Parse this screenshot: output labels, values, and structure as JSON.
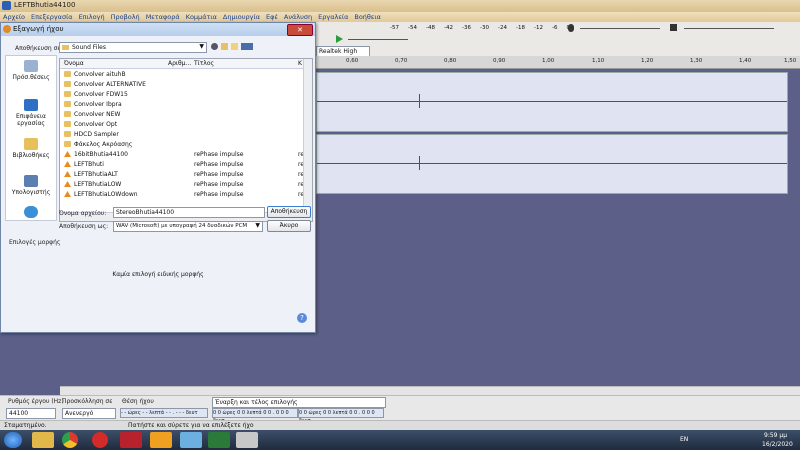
{
  "window": {
    "title": "LEFTBhutia44100"
  },
  "menu": [
    "Αρχείο",
    "Επεξεργασία",
    "Επιλογή",
    "Προβολή",
    "Μεταφορά",
    "Κομμάτια",
    "Δημιουργία",
    "Εφέ",
    "Ανάλυση",
    "Εργαλεία",
    "Βοήθεια"
  ],
  "toolbar": {
    "level_ticks": [
      "-57",
      "-54",
      "-48",
      "-42",
      "-36",
      "-30",
      "-24",
      "-18",
      "-12",
      "-6",
      "0"
    ],
    "device": "Realtek High"
  },
  "timeline": {
    "ticks": [
      "0,60",
      "0,70",
      "0,80",
      "0,90",
      "1,00",
      "1,10",
      "1,20",
      "1,30",
      "1,40",
      "1,50"
    ]
  },
  "dialog": {
    "title": "Εξαγωγή ήχου",
    "save_in_label": "Αποθήκευση σε:",
    "save_in_value": "Sound Files",
    "places": [
      "Πρόσ.θέσεις",
      "Επιφάνεια εργασίας",
      "Βιβλιοθήκες",
      "Υπολογιστής",
      ""
    ],
    "columns": {
      "name": "Όνομα",
      "number": "Αριθμ...",
      "title": "Τίτλος",
      "extra": "K"
    },
    "files": [
      {
        "name": "Convolver aituhB",
        "title": "",
        "extra": "",
        "type": "folder"
      },
      {
        "name": "Convolver ALTERNATIVE",
        "title": "",
        "extra": "",
        "type": "folder"
      },
      {
        "name": "Convolver FDW15",
        "title": "",
        "extra": "",
        "type": "folder"
      },
      {
        "name": "Convolver Ibpra",
        "title": "",
        "extra": "",
        "type": "folder"
      },
      {
        "name": "Convolver NEW",
        "title": "",
        "extra": "",
        "type": "folder"
      },
      {
        "name": "Convolver Opt",
        "title": "",
        "extra": "",
        "type": "folder"
      },
      {
        "name": "HDCD Sampler",
        "title": "",
        "extra": "",
        "type": "folder"
      },
      {
        "name": "Φάκελος Ακρόασης",
        "title": "",
        "extra": "",
        "type": "folder"
      },
      {
        "name": "16bitBhutia44100",
        "title": "rePhase impulse",
        "extra": "re",
        "type": "audio"
      },
      {
        "name": "LEFTBhuti",
        "title": "rePhase impulse",
        "extra": "re",
        "type": "audio"
      },
      {
        "name": "LEFTBhutiaALT",
        "title": "rePhase impulse",
        "extra": "re",
        "type": "audio"
      },
      {
        "name": "LEFTBhutiaLOW",
        "title": "rePhase impulse",
        "extra": "re",
        "type": "audio"
      },
      {
        "name": "LEFTBhutiaLOWdown",
        "title": "rePhase impulse",
        "extra": "re",
        "type": "audio"
      }
    ],
    "filename_label": "Όνομα αρχείου:",
    "filename_value": "StereoBhutia44100",
    "save_as_label": "Αποθήκευση ως:",
    "save_as_value": "WAV (Microsoft) με υπογραφή 24 δυαδικών PCM",
    "save_button": "Αποθήκευση",
    "cancel_button": "Άκυρο",
    "format_options_label": "Επιλογές μορφής",
    "no_format_options": "Καμία επιλογή ειδικής μορφής"
  },
  "bottom": {
    "rate_label": "Ρυθμός έργου (Hz)",
    "rate_value": "44100",
    "snap_label": "Προσκόλληση σε",
    "snap_value": "Ανενεργό",
    "pos_label": "Θέση ήχου",
    "pos_value": "- - ώρες - - λεπτά - - . - - - δευτ",
    "sel_label": "Έναρξη και τέλος επιλογής",
    "sel_start": "0 0 ώρες 0 0 λεπτά 0 0 . 0 0 0 δευτ",
    "sel_end": "0 0 ώρες 0 0 λεπτά 0 0 . 0 0 0 δευτ"
  },
  "status": {
    "left": "Σταματημένο.",
    "center": "Πατήστε και σύρετε για να επιλέξετε ήχο"
  },
  "taskbar": {
    "lang": "EN",
    "time": "9:59 μμ",
    "date": "16/2/2020"
  }
}
